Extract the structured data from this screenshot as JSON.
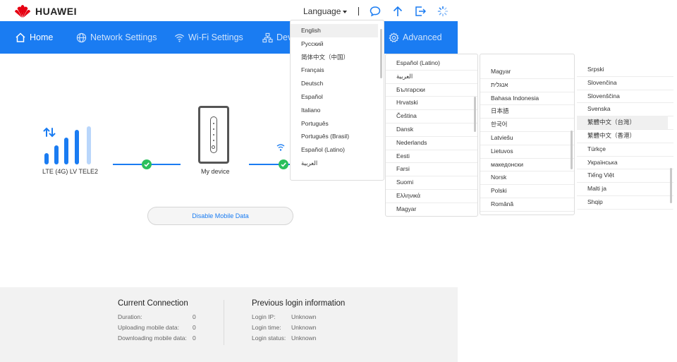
{
  "header": {
    "brand": "HUAWEI",
    "language_label": "Language",
    "icons": [
      "chat-icon",
      "upload-icon",
      "logout-icon",
      "loading-icon"
    ]
  },
  "nav": {
    "items": [
      {
        "label": "Home",
        "icon": "home-icon"
      },
      {
        "label": "Network Settings",
        "icon": "globe-icon"
      },
      {
        "label": "Wi-Fi Settings",
        "icon": "wifi-icon"
      },
      {
        "label": "Dev",
        "icon": "device-tree-icon"
      },
      {
        "label": "Advanced",
        "icon": "gear-icon"
      }
    ]
  },
  "topology": {
    "network_label": "LTE (4G) LV TELE2",
    "device_label": "My device"
  },
  "actions": {
    "disable_mobile_data": "Disable Mobile Data"
  },
  "current_connection": {
    "title": "Current Connection",
    "rows": [
      {
        "label": "Duration:",
        "value": "0"
      },
      {
        "label": "Uploading mobile data:",
        "value": "0"
      },
      {
        "label": "Downloading mobile data:",
        "value": "0"
      }
    ]
  },
  "previous_login": {
    "title": "Previous login information",
    "rows": [
      {
        "label": "Login IP:",
        "value": "Unknown"
      },
      {
        "label": "Login time:",
        "value": "Unknown"
      },
      {
        "label": "Login status:",
        "value": "Unknown"
      }
    ]
  },
  "language_menu": {
    "column1": [
      "English",
      "Русский",
      "简体中文（中国）",
      "Français",
      "Deutsch",
      "Español",
      "Italiano",
      "Português",
      "Português (Brasil)",
      "Español (Latino)",
      "العربية"
    ],
    "column2": [
      "Español (Latino)",
      "العربية",
      "Български",
      "Hrvatski",
      "Čeština",
      "Dansk",
      "Nederlands",
      "Eesti",
      "Farsi",
      "Suomi",
      "Ελληνικά",
      "Magyar"
    ],
    "column3": [
      "Magyar",
      "אנגלית",
      "Bahasa Indonesia",
      "日本語",
      "한국어",
      "Latviešu",
      "Lietuvos",
      "македонски",
      "Norsk",
      "Polski",
      "Română"
    ],
    "column4": [
      "Srpski",
      "Slovenčina",
      "Slovenščina",
      "Svenska",
      "繁體中文（台灣）",
      "繁體中文（香港）",
      "Türkçe",
      "Українська",
      "Tiếng Việt",
      "Malti ja",
      "Shqip"
    ],
    "selected": "English"
  },
  "colors": {
    "accent": "#1a7cf2",
    "success": "#2bbf5d",
    "brand_red": "#e60012"
  }
}
